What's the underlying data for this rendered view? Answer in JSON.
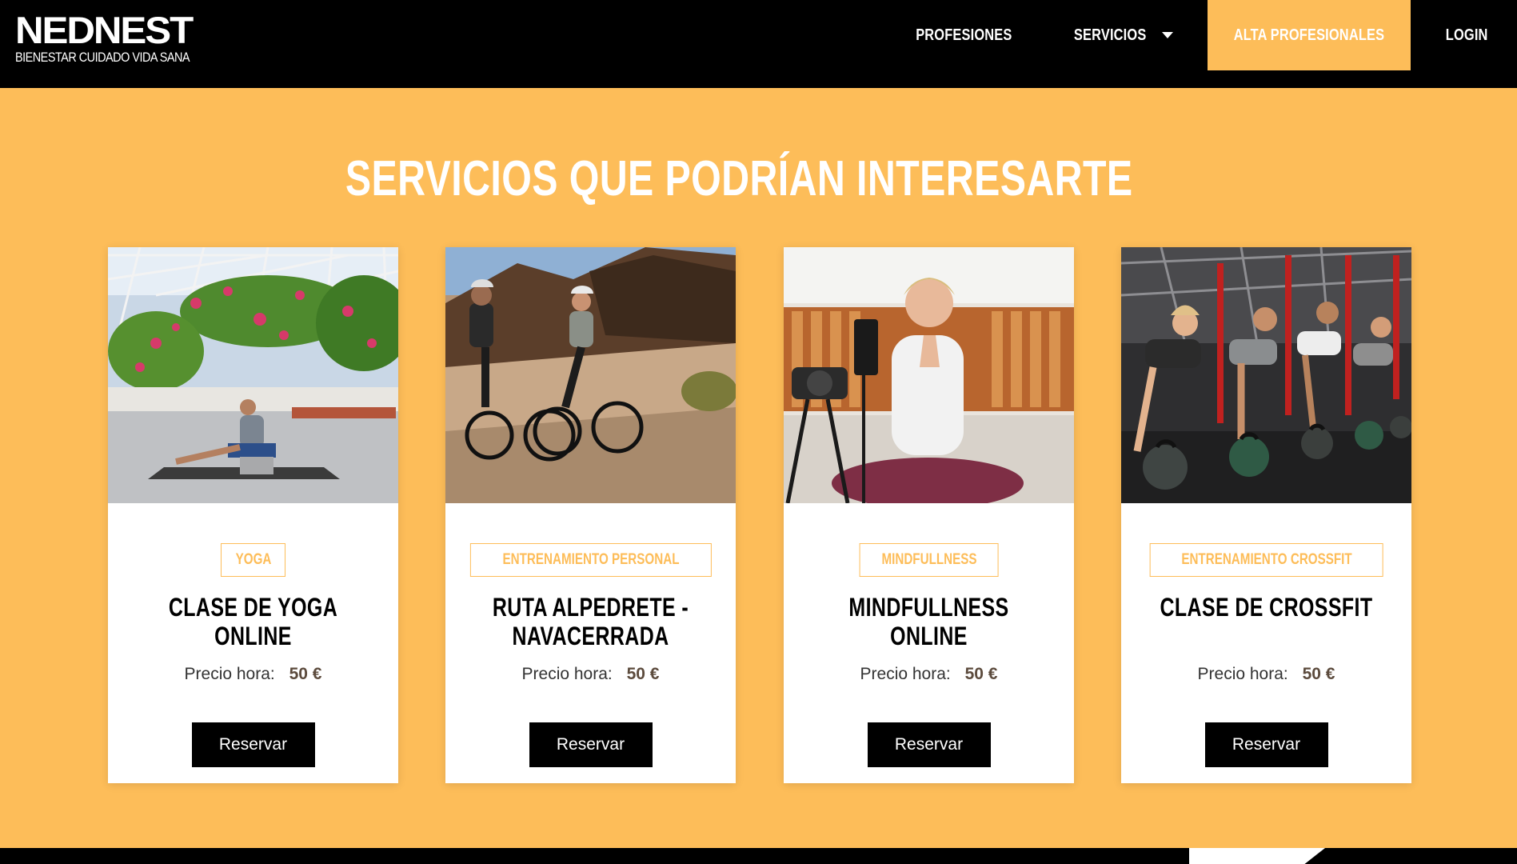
{
  "header": {
    "logo_text": "NEDNEST",
    "logo_tagline": "BIENESTAR CUIDADO VIDA SANA",
    "nav": {
      "profesiones": "PROFESIONES",
      "servicios": "SERVICIOS",
      "alta_profesionales": "ALTA PROFESIONALES",
      "login": "LOGIN"
    }
  },
  "colors": {
    "accent": "#fdbd59",
    "header_bg": "#000000",
    "button_bg": "#000000",
    "card_bg": "#ffffff"
  },
  "section": {
    "title": "SERVICIOS QUE PODRÍAN INTERESARTE"
  },
  "cards": [
    {
      "image": "yoga-photo",
      "tag": "YOGA",
      "title": "CLASE DE YOGA ONLINE",
      "price_label": "Precio hora:",
      "price_value": "50 €",
      "button": "Reservar"
    },
    {
      "image": "cycling-photo",
      "tag": "ENTRENAMIENTO PERSONAL",
      "title": "RUTA ALPEDRETE - NAVACERRADA",
      "price_label": "Precio hora:",
      "price_value": "50 €",
      "button": "Reservar"
    },
    {
      "image": "mindfulness-photo",
      "tag": "MINDFULLNESS",
      "title": "MINDFULLNESS ONLINE",
      "price_label": "Precio hora:",
      "price_value": "50 €",
      "button": "Reservar"
    },
    {
      "image": "crossfit-photo",
      "tag": "ENTRENAMIENTO CROSSFIT",
      "title": "CLASE DE CROSSFIT",
      "price_label": "Precio hora:",
      "price_value": "50 €",
      "button": "Reservar"
    }
  ]
}
